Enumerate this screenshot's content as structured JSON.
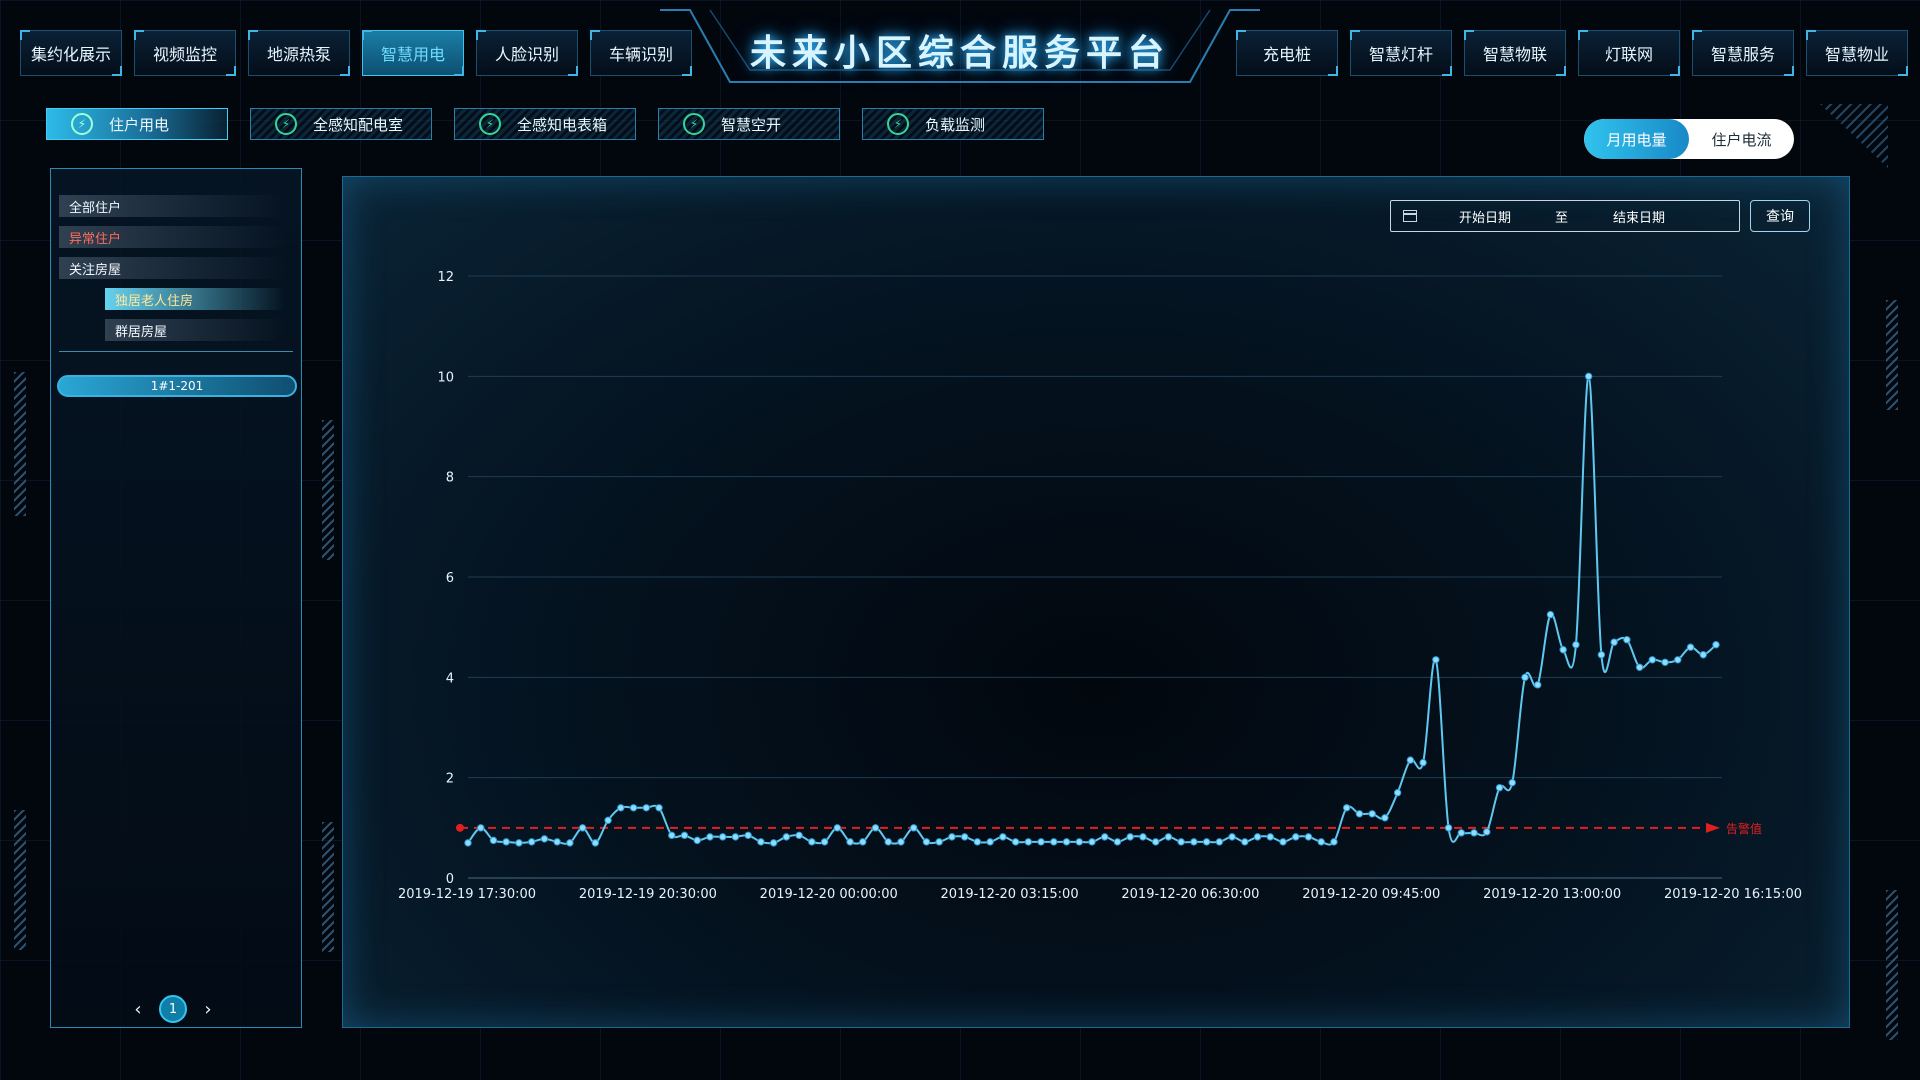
{
  "header": {
    "title": "未来小区综合服务平台"
  },
  "nav_left": [
    {
      "label": "集约化展示",
      "active": false
    },
    {
      "label": "视频监控",
      "active": false
    },
    {
      "label": "地源热泵",
      "active": false
    },
    {
      "label": "智慧用电",
      "active": true
    },
    {
      "label": "人脸识别",
      "active": false
    },
    {
      "label": "车辆识别",
      "active": false
    }
  ],
  "nav_right": [
    {
      "label": "充电桩"
    },
    {
      "label": "智慧灯杆"
    },
    {
      "label": "智慧物联"
    },
    {
      "label": "灯联网"
    },
    {
      "label": "智慧服务"
    },
    {
      "label": "智慧物业"
    }
  ],
  "subtabs": [
    {
      "label": "住户用电",
      "icon": "bolt-icon",
      "active": true
    },
    {
      "label": "全感知配电室",
      "icon": "bolt-icon",
      "active": false
    },
    {
      "label": "全感知电表箱",
      "icon": "bolt-icon",
      "active": false
    },
    {
      "label": "智慧空开",
      "icon": "bolt-icon",
      "active": false
    },
    {
      "label": "负载监测",
      "icon": "bolt-icon",
      "active": false
    }
  ],
  "toggle": {
    "option_a": "月用电量",
    "option_b": "住户电流",
    "selected": "option_a"
  },
  "sidebar": {
    "tree": [
      {
        "label": "全部住户",
        "level": 0,
        "state": "normal"
      },
      {
        "label": "异常住户",
        "level": 0,
        "state": "warn"
      },
      {
        "label": "关注房屋",
        "level": 0,
        "state": "normal"
      },
      {
        "label": "独居老人住房",
        "level": 1,
        "state": "selected"
      },
      {
        "label": "群居房屋",
        "level": 1,
        "state": "normal"
      }
    ],
    "room": "1#1-201",
    "pager": {
      "prev": "‹",
      "page": "1",
      "next": "›"
    }
  },
  "filter": {
    "start_placeholder": "开始日期",
    "separator": "至",
    "end_placeholder": "结束日期",
    "query_label": "查询"
  },
  "colors": {
    "accent": "#3fc4ef",
    "line": "#5fc8f0",
    "threshold": "#e02020",
    "warn_text": "#ff6b5a"
  },
  "chart_data": {
    "type": "line",
    "x_tick_labels": [
      "2019-12-19 17:30:00",
      "2019-12-19 20:30:00",
      "2019-12-20 00:00:00",
      "2019-12-20 03:15:00",
      "2019-12-20 06:30:00",
      "2019-12-20 09:45:00",
      "2019-12-20 13:00:00",
      "2019-12-20 16:15:00"
    ],
    "y_ticks": [
      0,
      2,
      4,
      6,
      8,
      10,
      12
    ],
    "ylim": [
      0,
      12
    ],
    "grid": true,
    "threshold": {
      "value": 1.0,
      "label": "告警值"
    },
    "values": [
      0.7,
      1.0,
      0.75,
      0.72,
      0.7,
      0.72,
      0.78,
      0.72,
      0.7,
      1.0,
      0.7,
      1.15,
      1.4,
      1.4,
      1.4,
      1.4,
      0.85,
      0.85,
      0.75,
      0.82,
      0.82,
      0.82,
      0.85,
      0.72,
      0.7,
      0.82,
      0.85,
      0.72,
      0.72,
      1.0,
      0.72,
      0.72,
      1.0,
      0.72,
      0.72,
      1.0,
      0.72,
      0.72,
      0.82,
      0.82,
      0.72,
      0.72,
      0.82,
      0.72,
      0.72,
      0.72,
      0.72,
      0.72,
      0.72,
      0.72,
      0.82,
      0.72,
      0.82,
      0.82,
      0.72,
      0.82,
      0.72,
      0.72,
      0.72,
      0.72,
      0.82,
      0.72,
      0.82,
      0.82,
      0.72,
      0.82,
      0.82,
      0.72,
      0.72,
      1.4,
      1.28,
      1.28,
      1.2,
      1.7,
      2.35,
      2.3,
      4.35,
      1.0,
      0.9,
      0.9,
      0.92,
      1.8,
      1.9,
      4.0,
      3.85,
      5.25,
      4.55,
      4.65,
      10.0,
      4.45,
      4.7,
      4.75,
      4.2,
      4.35,
      4.3,
      4.35,
      4.6,
      4.45,
      4.65
    ]
  }
}
